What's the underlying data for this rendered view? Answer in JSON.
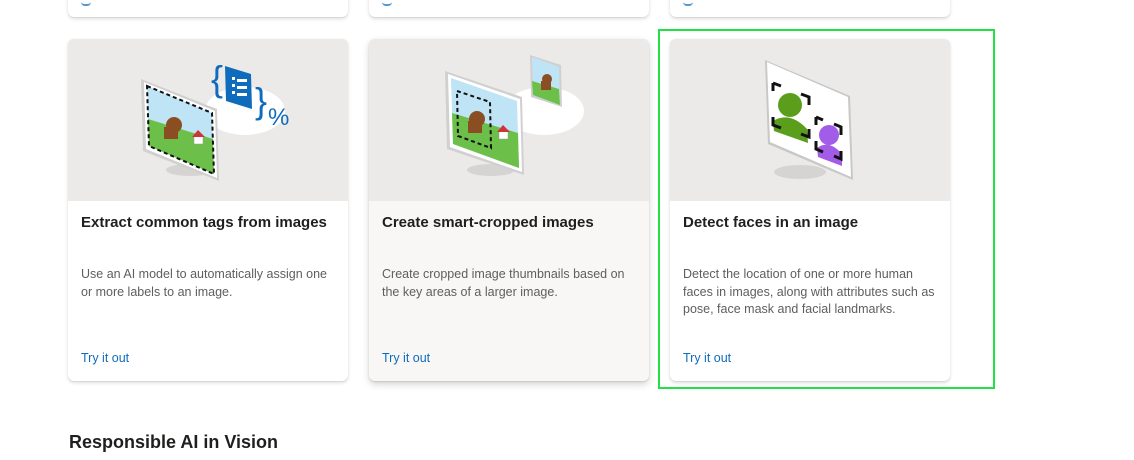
{
  "cards": [
    {
      "title": "Extract common tags from images",
      "description": "Use an AI model to automatically assign one or more labels to an image.",
      "link": "Try it out",
      "illustration": "tag-extraction-illustration"
    },
    {
      "title": "Create smart-cropped images",
      "description": "Create cropped image thumbnails based on the key areas of a larger image.",
      "link": "Try it out",
      "illustration": "smart-crop-illustration"
    },
    {
      "title": "Detect faces in an image",
      "description": "Detect the location of one or more human faces in images, along with attributes such as pose, face mask and facial landmarks.",
      "link": "Try it out",
      "illustration": "face-detection-illustration"
    }
  ],
  "section_heading": "Responsible AI in Vision",
  "colors": {
    "link": "#0f6cbd",
    "card_illustration_bg": "#ebeae9",
    "highlight": "#22e045",
    "face_green": "#5a9e1b",
    "face_purple": "#a35ce8"
  }
}
